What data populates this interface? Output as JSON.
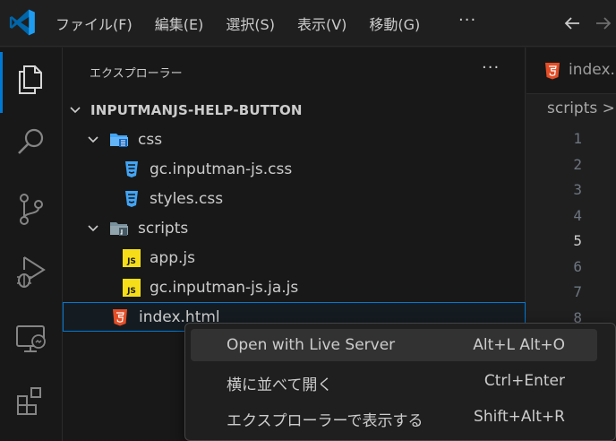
{
  "menubar": {
    "items": [
      "ファイル(F)",
      "編集(E)",
      "選択(S)",
      "表示(V)",
      "移動(G)"
    ],
    "more": "···"
  },
  "explorer": {
    "title": "エクスプローラー",
    "more": "···",
    "root": "INPUTMANJS-HELP-BUTTON",
    "tree": [
      {
        "label": "css",
        "kind": "folder-css",
        "depth": 1,
        "expanded": true
      },
      {
        "label": "gc.inputman-js.css",
        "kind": "css-file",
        "depth": 2
      },
      {
        "label": "styles.css",
        "kind": "css-file",
        "depth": 2
      },
      {
        "label": "scripts",
        "kind": "folder-scripts",
        "depth": 1,
        "expanded": true
      },
      {
        "label": "app.js",
        "kind": "js-file",
        "depth": 2
      },
      {
        "label": "gc.inputman-js.ja.js",
        "kind": "js-file",
        "depth": 2
      },
      {
        "label": "index.html",
        "kind": "html-file",
        "depth": 1,
        "selected": true
      }
    ],
    "js_badge": "JS"
  },
  "editor": {
    "tab_label": "index.l",
    "breadcrumb": "scripts >",
    "line_numbers": [
      "1",
      "2",
      "3",
      "4",
      "5",
      "6",
      "7",
      "8"
    ],
    "current_line": "5"
  },
  "context_menu": {
    "items": [
      {
        "label": "Open with Live Server",
        "shortcut": "Alt+L Alt+O",
        "highlighted": true
      },
      {
        "label": "横に並べて開く",
        "shortcut": "Ctrl+Enter"
      },
      {
        "label": "エクスプローラーで表示する",
        "shortcut": "Shift+Alt+R"
      }
    ]
  },
  "colors": {
    "accent": "#0078d4",
    "css_icon": "#42a5f5",
    "js_icon": "#f5de19",
    "html_icon": "#e44d26"
  }
}
